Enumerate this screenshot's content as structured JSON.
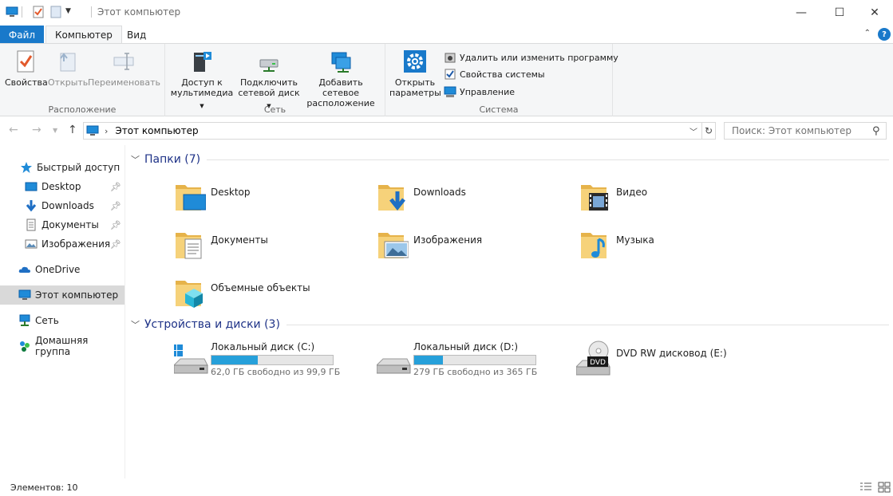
{
  "window": {
    "title": "Этот компьютер",
    "minimize_glyph": "—",
    "maximize_glyph": "☐",
    "close_glyph": "✕"
  },
  "ribbon_tabs": {
    "file": "Файл",
    "computer": "Компьютер",
    "view": "Вид",
    "help": "?"
  },
  "ribbon": {
    "location_group": {
      "label": "Расположение",
      "properties": "Свойства",
      "open": "Открыть",
      "rename": "Переименовать"
    },
    "network_group": {
      "label": "Сеть",
      "media_access_line1": "Доступ к",
      "media_access_line2": "мультимедиа",
      "map_drive_line1": "Подключить",
      "map_drive_line2": "сетевой диск",
      "add_location_line1": "Добавить сетевое",
      "add_location_line2": "расположение"
    },
    "system_group": {
      "label": "Система",
      "open_settings_line1": "Открыть",
      "open_settings_line2": "параметры",
      "uninstall": "Удалить или изменить программу",
      "system_properties": "Свойства системы",
      "manage": "Управление"
    }
  },
  "address_bar": {
    "path": "Этот компьютер",
    "search_placeholder": "Поиск: Этот компьютер"
  },
  "sidebar": {
    "quick_access": "Быстрый доступ",
    "desktop": "Desktop",
    "downloads": "Downloads",
    "documents": "Документы",
    "pictures": "Изображения",
    "onedrive": "OneDrive",
    "this_pc": "Этот компьютер",
    "network": "Сеть",
    "homegroup": "Домашняя группа"
  },
  "folders": {
    "header": "Папки (7)",
    "items": [
      {
        "name": "Desktop"
      },
      {
        "name": "Downloads"
      },
      {
        "name": "Видео"
      },
      {
        "name": "Документы"
      },
      {
        "name": "Изображения"
      },
      {
        "name": "Музыка"
      },
      {
        "name": "Объемные объекты"
      }
    ]
  },
  "devices": {
    "header": "Устройства и диски (3)",
    "items": [
      {
        "name": "Локальный диск (C:)",
        "free": "62,0 ГБ свободно из 99,9 ГБ",
        "used_fraction": 0.38
      },
      {
        "name": "Локальный диск (D:)",
        "free": "279 ГБ свободно из 365 ГБ",
        "used_fraction": 0.24
      },
      {
        "name": "DVD RW дисковод (E:)",
        "dvd_label": "DVD"
      }
    ]
  },
  "status": {
    "items_count": "Элементов: 10"
  },
  "colors": {
    "accent": "#1979ca",
    "drive_bar": "#26a0da",
    "folder_yellow": "#f4c542"
  }
}
